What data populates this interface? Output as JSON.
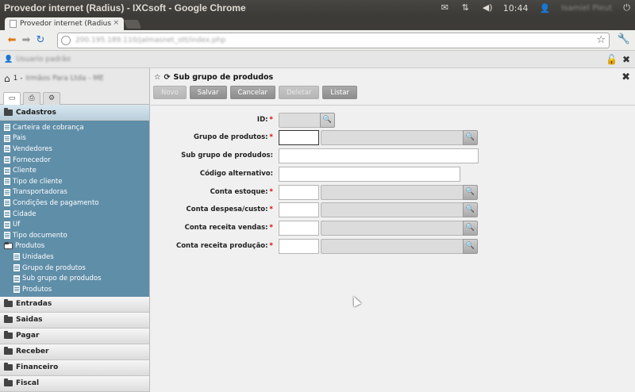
{
  "window": {
    "title": "Provedor internet (Radius) - IXCsoft - Google Chrome",
    "clock": "10:44",
    "user_blurred": "Isamiel Pleut"
  },
  "browser": {
    "tab_label": "Provedor internet (Radius",
    "tab_close": "×",
    "url": "200.195.189.110/jalmasnet_ott/index.php"
  },
  "appbar": {
    "user_blurred": "Usuario padrão",
    "branch": "1 - ",
    "branch_blurred": "Irmãos Para Ltda - ME"
  },
  "sidebar": {
    "sections": [
      {
        "label": "Cadastros",
        "open": true
      },
      {
        "label": "Entradas"
      },
      {
        "label": "Saidas"
      },
      {
        "label": "Pagar"
      },
      {
        "label": "Receber"
      },
      {
        "label": "Financeiro"
      },
      {
        "label": "Fiscal"
      }
    ],
    "cadastros_items": [
      "Carteira de cobrança",
      "Pais",
      "Vendedores",
      "Fornecedor",
      "Cliente",
      "Tipo de cliente",
      "Transportadoras",
      "Condições de pagamento",
      "Cidade",
      "Uf",
      "Tipo documento"
    ],
    "produtos_folder": "Produtos",
    "produtos_items": [
      "Unidades",
      "Grupo de produtos",
      "Sub grupo de produdos",
      "Produtos"
    ]
  },
  "page": {
    "title": "Sub grupo de produdos",
    "buttons": {
      "novo": "Novo",
      "salvar": "Salvar",
      "cancelar": "Cancelar",
      "deletar": "Deletar",
      "listar": "Listar"
    },
    "fields": [
      {
        "label": "ID:",
        "required": true
      },
      {
        "label": "Grupo de produtos:",
        "required": true
      },
      {
        "label": "Sub grupo de produdos:",
        "required": false
      },
      {
        "label": "Código alternativo:",
        "required": false
      },
      {
        "label": "Conta estoque:",
        "required": true
      },
      {
        "label": "Conta despesa/custo:",
        "required": true
      },
      {
        "label": "Conta receita vendas:",
        "required": true
      },
      {
        "label": "Conta receita produção:",
        "required": true
      }
    ],
    "required_mark": "*"
  }
}
